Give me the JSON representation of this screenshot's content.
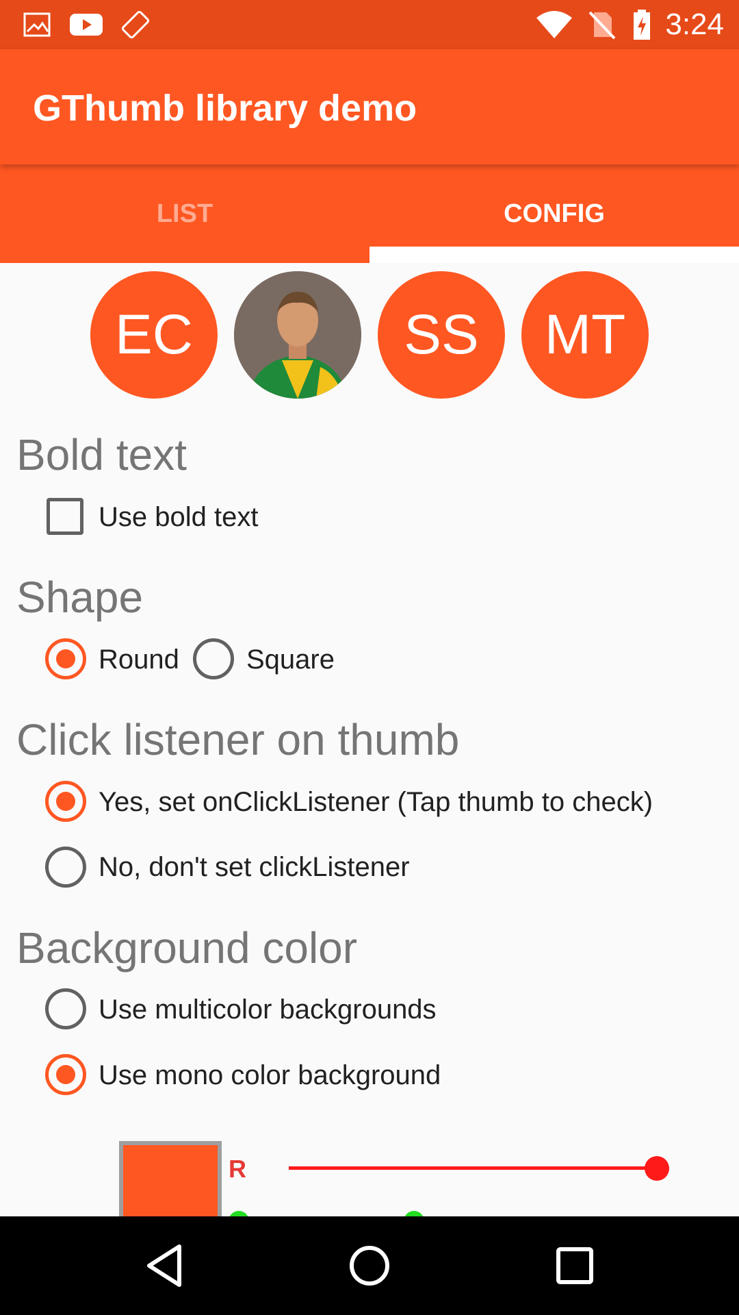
{
  "status_bar": {
    "time": "3:24",
    "icons": [
      "image-icon",
      "youtube-icon",
      "screen-rotation-icon",
      "wifi-icon",
      "no-sim-icon",
      "battery-charging-icon"
    ]
  },
  "app_bar": {
    "title": "GThumb library demo"
  },
  "tabs": [
    {
      "label": "LIST",
      "selected": false
    },
    {
      "label": "CONFIG",
      "selected": true
    }
  ],
  "thumbs": [
    {
      "initials": "EC",
      "type": "initials"
    },
    {
      "initials": "",
      "type": "photo"
    },
    {
      "initials": "SS",
      "type": "initials"
    },
    {
      "initials": "MT",
      "type": "initials"
    }
  ],
  "sections": {
    "bold_text": {
      "title": "Bold text",
      "option_label": "Use bold text",
      "checked": false
    },
    "shape": {
      "title": "Shape",
      "options": [
        {
          "label": "Round",
          "checked": true
        },
        {
          "label": "Square",
          "checked": false
        }
      ]
    },
    "click_listener": {
      "title": "Click listener on thumb",
      "options": [
        {
          "label": "Yes, set onClickListener (Tap thumb to check)",
          "checked": true
        },
        {
          "label": "No, don't set clickListener",
          "checked": false
        }
      ]
    },
    "background_color": {
      "title": "Background color",
      "options": [
        {
          "label": "Use multicolor backgrounds",
          "checked": false
        },
        {
          "label": "Use mono color background",
          "checked": true
        }
      ]
    }
  },
  "color_picker": {
    "preview_color": "#ff5722",
    "channel_label": "R",
    "r_value_fraction": 1.0
  },
  "colors": {
    "primary": "#ff5722",
    "primary_dark": "#e64a19",
    "slider_red": "#ff1a1a"
  },
  "nav_bar": {
    "buttons": [
      "back-icon",
      "home-icon",
      "recents-icon"
    ]
  }
}
